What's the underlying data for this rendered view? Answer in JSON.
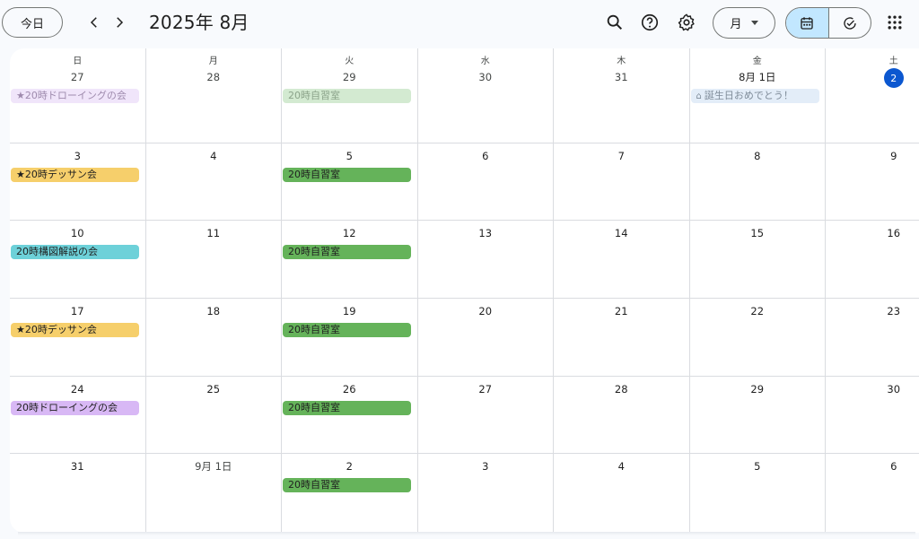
{
  "header": {
    "today_label": "今日",
    "title": "2025年 8月",
    "view_label": "月"
  },
  "icons": {
    "prev": "chevron-left-icon",
    "next": "chevron-right-icon",
    "search": "search-icon",
    "help": "help-icon",
    "settings": "gear-icon",
    "calendar": "calendar-icon",
    "tasks": "check-circle-icon",
    "apps": "apps-grid-icon"
  },
  "colors": {
    "accent": "#0b57d0",
    "active_segment": "#c2e7ff",
    "event_yellow": "#f6cf6b",
    "event_green": "#65b35a",
    "event_cyan": "#6dd1d9",
    "event_lavender": "#d8b8f5"
  },
  "weekdays": [
    "日",
    "月",
    "火",
    "水",
    "木",
    "金",
    "土"
  ],
  "weeks": [
    {
      "days": [
        {
          "label": "27",
          "muted": true,
          "events": [
            {
              "title": "★20時ドローイングの会",
              "style": "purple-past"
            }
          ]
        },
        {
          "label": "28",
          "muted": true,
          "events": []
        },
        {
          "label": "29",
          "muted": true,
          "events": [
            {
              "title": "20時自習室",
              "style": "green-past"
            }
          ]
        },
        {
          "label": "30",
          "muted": true,
          "events": []
        },
        {
          "label": "31",
          "muted": true,
          "events": []
        },
        {
          "label": "8月 1日",
          "muted": false,
          "events": [
            {
              "title": "誕生日おめでとう！",
              "style": "blue-past",
              "icon": "cake-icon"
            }
          ]
        },
        {
          "label": "2",
          "today": true,
          "events": []
        }
      ]
    },
    {
      "days": [
        {
          "label": "3",
          "events": [
            {
              "title": "★20時デッサン会",
              "style": "yellow"
            }
          ]
        },
        {
          "label": "4",
          "events": []
        },
        {
          "label": "5",
          "events": [
            {
              "title": "20時自習室",
              "style": "green"
            }
          ]
        },
        {
          "label": "6",
          "events": []
        },
        {
          "label": "7",
          "events": []
        },
        {
          "label": "8",
          "events": []
        },
        {
          "label": "9",
          "events": []
        }
      ]
    },
    {
      "days": [
        {
          "label": "10",
          "events": [
            {
              "title": "20時構図解説の会",
              "style": "cyan"
            }
          ]
        },
        {
          "label": "11",
          "events": []
        },
        {
          "label": "12",
          "events": [
            {
              "title": "20時自習室",
              "style": "green"
            }
          ]
        },
        {
          "label": "13",
          "events": []
        },
        {
          "label": "14",
          "events": []
        },
        {
          "label": "15",
          "events": []
        },
        {
          "label": "16",
          "events": []
        }
      ]
    },
    {
      "days": [
        {
          "label": "17",
          "events": [
            {
              "title": "★20時デッサン会",
              "style": "yellow"
            }
          ]
        },
        {
          "label": "18",
          "events": []
        },
        {
          "label": "19",
          "events": [
            {
              "title": "20時自習室",
              "style": "green"
            }
          ]
        },
        {
          "label": "20",
          "events": []
        },
        {
          "label": "21",
          "events": []
        },
        {
          "label": "22",
          "events": []
        },
        {
          "label": "23",
          "events": []
        }
      ]
    },
    {
      "days": [
        {
          "label": "24",
          "events": [
            {
              "title": "20時ドローイングの会",
              "style": "lavender"
            }
          ]
        },
        {
          "label": "25",
          "events": []
        },
        {
          "label": "26",
          "events": [
            {
              "title": "20時自習室",
              "style": "green"
            }
          ]
        },
        {
          "label": "27",
          "events": []
        },
        {
          "label": "28",
          "events": []
        },
        {
          "label": "29",
          "events": []
        },
        {
          "label": "30",
          "events": []
        }
      ]
    },
    {
      "days": [
        {
          "label": "31",
          "events": []
        },
        {
          "label": "9月 1日",
          "muted": true,
          "events": []
        },
        {
          "label": "2",
          "events": [
            {
              "title": "20時自習室",
              "style": "green"
            }
          ]
        },
        {
          "label": "3",
          "events": []
        },
        {
          "label": "4",
          "events": []
        },
        {
          "label": "5",
          "events": []
        },
        {
          "label": "6",
          "events": []
        }
      ]
    }
  ]
}
